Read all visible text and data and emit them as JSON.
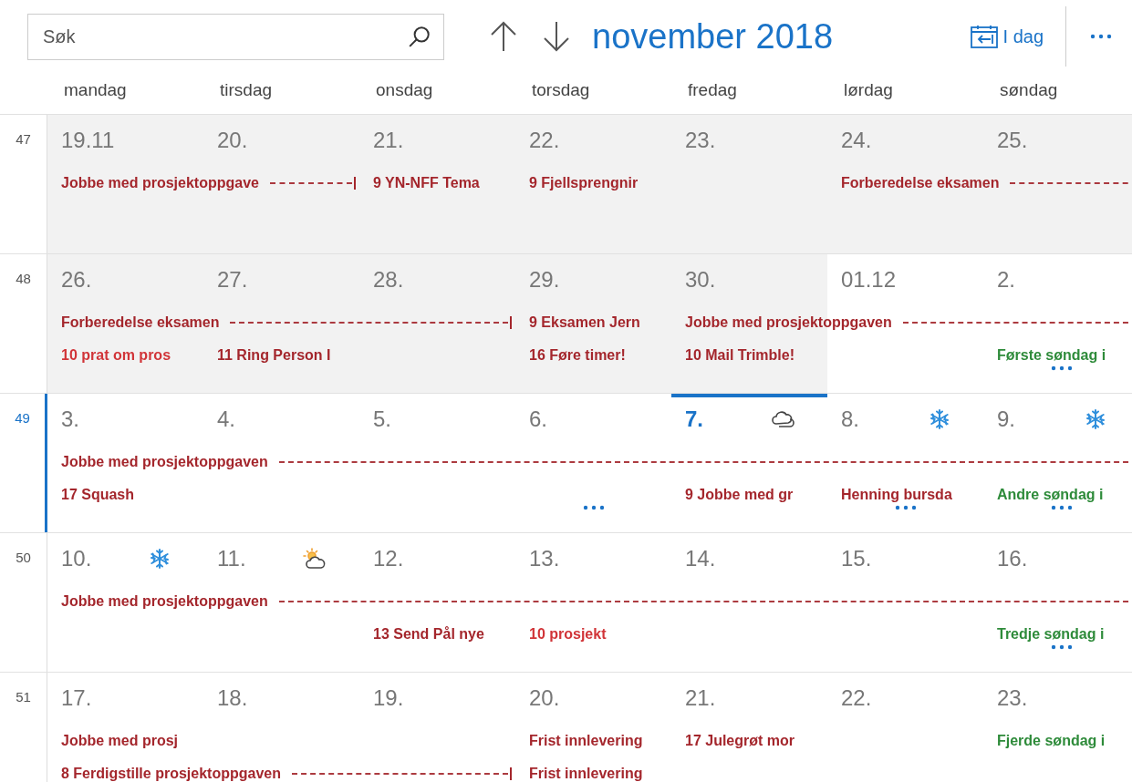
{
  "search": {
    "placeholder": "Søk"
  },
  "title": "november 2018",
  "today_button": "I dag",
  "weekdays": [
    "mandag",
    "tirsdag",
    "onsdag",
    "torsdag",
    "fredag",
    "lørdag",
    "søndag"
  ],
  "weeks": [
    {
      "number": "47",
      "current": false,
      "days": [
        {
          "date": "19.11",
          "past": true,
          "today": false,
          "more": false
        },
        {
          "date": "20.",
          "past": true,
          "today": false,
          "more": false
        },
        {
          "date": "21.",
          "past": true,
          "today": false,
          "more": false
        },
        {
          "date": "22.",
          "past": true,
          "today": false,
          "more": false
        },
        {
          "date": "23.",
          "past": true,
          "today": false,
          "more": false
        },
        {
          "date": "24.",
          "past": true,
          "today": false,
          "more": false
        },
        {
          "date": "25.",
          "past": true,
          "today": false,
          "more": false
        }
      ],
      "lanes": [
        [
          {
            "kind": "event",
            "text": "Jobbe med prosjektoppgave",
            "color": "#a4262c",
            "end_mark": true
          },
          {
            "kind": "continued"
          },
          {
            "kind": "event",
            "text": "9 YN-NFF Tema",
            "color": "#a4262c"
          },
          {
            "kind": "event",
            "text": "9 Fjellsprengnir",
            "color": "#a4262c"
          },
          {
            "kind": "empty"
          },
          {
            "kind": "event",
            "text": "Forberedelse eksamen",
            "color": "#a4262c"
          },
          {
            "kind": "continued"
          }
        ]
      ]
    },
    {
      "number": "48",
      "current": false,
      "days": [
        {
          "date": "26.",
          "past": true,
          "today": false,
          "more": false
        },
        {
          "date": "27.",
          "past": true,
          "today": false,
          "more": false
        },
        {
          "date": "28.",
          "past": true,
          "today": false,
          "more": false
        },
        {
          "date": "29.",
          "past": true,
          "today": false,
          "more": false
        },
        {
          "date": "30.",
          "past": true,
          "today": false,
          "more": false
        },
        {
          "date": "01.12",
          "past": false,
          "today": false,
          "more": false
        },
        {
          "date": "2.",
          "past": false,
          "today": false,
          "more": true
        }
      ],
      "lanes": [
        [
          {
            "kind": "event",
            "text": "Forberedelse eksamen",
            "color": "#a4262c",
            "end_mark": true
          },
          {
            "kind": "continued"
          },
          {
            "kind": "continued"
          },
          {
            "kind": "event",
            "text": "9 Eksamen Jern",
            "color": "#a4262c"
          },
          {
            "kind": "event",
            "text": "Jobbe med prosjektoppgaven",
            "color": "#a4262c"
          },
          {
            "kind": "continued"
          },
          {
            "kind": "continued"
          }
        ],
        [
          {
            "kind": "event",
            "text": "10 prat om pros",
            "color": "#d13438"
          },
          {
            "kind": "event",
            "text": "11 Ring Person I",
            "color": "#a4262c"
          },
          {
            "kind": "empty"
          },
          {
            "kind": "event",
            "text": "16 Føre timer!",
            "color": "#a4262c"
          },
          {
            "kind": "event",
            "text": "10 Mail Trimble!",
            "color": "#a4262c"
          },
          {
            "kind": "empty"
          },
          {
            "kind": "event",
            "text": "Første søndag i",
            "color": "#2e8b3a"
          }
        ]
      ]
    },
    {
      "number": "49",
      "current": true,
      "days": [
        {
          "date": "3.",
          "past": false,
          "today": false,
          "more": false
        },
        {
          "date": "4.",
          "past": false,
          "today": false,
          "more": false
        },
        {
          "date": "5.",
          "past": false,
          "today": false,
          "more": false
        },
        {
          "date": "6.",
          "past": false,
          "today": false,
          "more": true
        },
        {
          "date": "7.",
          "past": false,
          "today": true,
          "weather": {
            "kind": "cloud"
          },
          "more": false
        },
        {
          "date": "8.",
          "past": false,
          "today": false,
          "weather": {
            "kind": "snow"
          },
          "more": true
        },
        {
          "date": "9.",
          "past": false,
          "today": false,
          "weather": {
            "kind": "snow"
          },
          "more": true
        }
      ],
      "lanes": [
        [
          {
            "kind": "event",
            "text": "Jobbe med prosjektoppgaven",
            "color": "#a4262c"
          },
          {
            "kind": "continued"
          },
          {
            "kind": "continued"
          },
          {
            "kind": "continued"
          },
          {
            "kind": "continued"
          },
          {
            "kind": "continued"
          },
          {
            "kind": "continued"
          }
        ],
        [
          {
            "kind": "event",
            "text": "17 Squash",
            "color": "#a4262c"
          },
          {
            "kind": "empty"
          },
          {
            "kind": "empty"
          },
          {
            "kind": "empty"
          },
          {
            "kind": "event",
            "text": "9 Jobbe med gr",
            "color": "#a4262c"
          },
          {
            "kind": "event",
            "text": "Henning bursda",
            "color": "#a4262c"
          },
          {
            "kind": "event",
            "text": "Andre søndag i",
            "color": "#2e8b3a"
          }
        ]
      ]
    },
    {
      "number": "50",
      "current": false,
      "days": [
        {
          "date": "10.",
          "past": false,
          "today": false,
          "weather": {
            "kind": "snow"
          },
          "more": false
        },
        {
          "date": "11.",
          "past": false,
          "today": false,
          "weather": {
            "kind": "sun_cloud"
          },
          "more": false
        },
        {
          "date": "12.",
          "past": false,
          "today": false,
          "more": false
        },
        {
          "date": "13.",
          "past": false,
          "today": false,
          "more": false
        },
        {
          "date": "14.",
          "past": false,
          "today": false,
          "more": false
        },
        {
          "date": "15.",
          "past": false,
          "today": false,
          "more": false
        },
        {
          "date": "16.",
          "past": false,
          "today": false,
          "more": true
        }
      ],
      "lanes": [
        [
          {
            "kind": "event",
            "text": "Jobbe med prosjektoppgaven",
            "color": "#a4262c"
          },
          {
            "kind": "continued"
          },
          {
            "kind": "continued"
          },
          {
            "kind": "continued"
          },
          {
            "kind": "continued"
          },
          {
            "kind": "continued"
          },
          {
            "kind": "continued"
          }
        ],
        [
          {
            "kind": "empty"
          },
          {
            "kind": "empty"
          },
          {
            "kind": "event",
            "text": "13 Send Pål nye",
            "color": "#a4262c"
          },
          {
            "kind": "event",
            "text": "10 prosjekt",
            "color": "#d13438"
          },
          {
            "kind": "empty"
          },
          {
            "kind": "empty"
          },
          {
            "kind": "event",
            "text": "Tredje søndag i",
            "color": "#2e8b3a"
          }
        ]
      ]
    },
    {
      "number": "51",
      "current": false,
      "days": [
        {
          "date": "17.",
          "past": false,
          "today": false,
          "more": false
        },
        {
          "date": "18.",
          "past": false,
          "today": false,
          "more": false
        },
        {
          "date": "19.",
          "past": false,
          "today": false,
          "more": false
        },
        {
          "date": "20.",
          "past": false,
          "today": false,
          "more": false
        },
        {
          "date": "21.",
          "past": false,
          "today": false,
          "more": false
        },
        {
          "date": "22.",
          "past": false,
          "today": false,
          "more": false
        },
        {
          "date": "23.",
          "past": false,
          "today": false,
          "more": false
        }
      ],
      "lanes": [
        [
          {
            "kind": "event",
            "text": "Jobbe med prosj",
            "color": "#a4262c"
          },
          {
            "kind": "empty"
          },
          {
            "kind": "empty"
          },
          {
            "kind": "event",
            "text": "Frist innlevering",
            "color": "#a4262c"
          },
          {
            "kind": "event",
            "text": "17 Julegrøt mor",
            "color": "#a4262c"
          },
          {
            "kind": "empty"
          },
          {
            "kind": "event",
            "text": "Fjerde søndag i",
            "color": "#2e8b3a"
          }
        ],
        [
          {
            "kind": "event",
            "text": "8 Ferdigstille prosjektoppgaven",
            "color": "#a4262c",
            "end_mark": true
          },
          {
            "kind": "continued"
          },
          {
            "kind": "continued"
          },
          {
            "kind": "event",
            "text": "Frist innlevering",
            "color": "#a4262c"
          },
          {
            "kind": "empty"
          },
          {
            "kind": "empty"
          },
          {
            "kind": "empty"
          }
        ]
      ]
    }
  ]
}
